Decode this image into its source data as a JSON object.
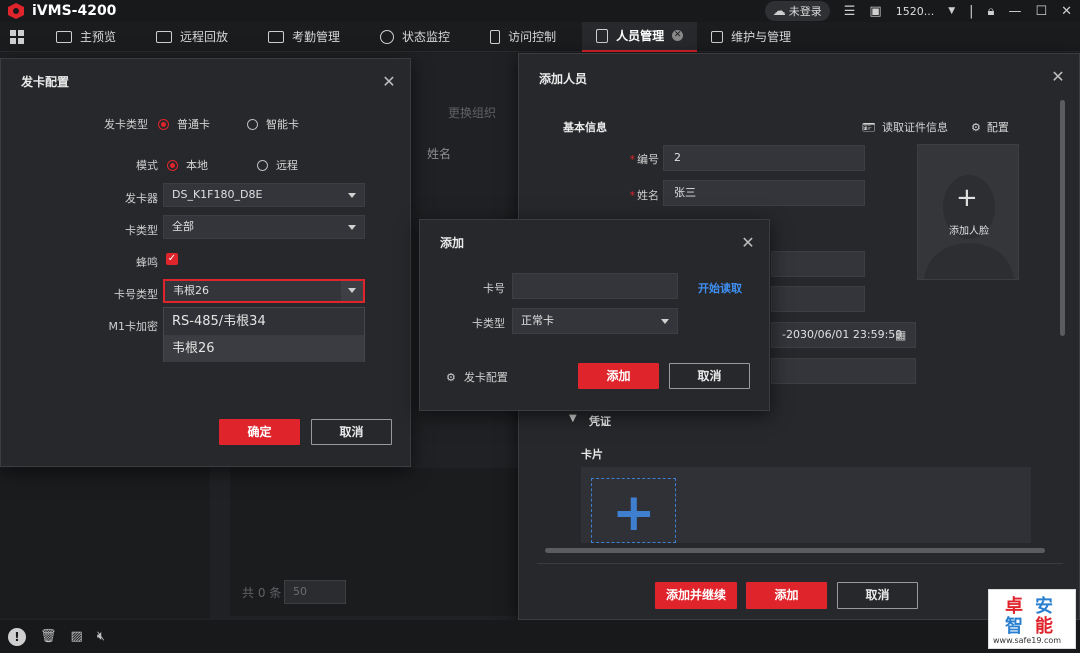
{
  "app": {
    "title": "iVMS-4200"
  },
  "titlebar": {
    "login": "未登录",
    "user": "1520..."
  },
  "nav": {
    "items": [
      {
        "label": "主预览"
      },
      {
        "label": "远程回放"
      },
      {
        "label": "考勤管理"
      },
      {
        "label": "状态监控"
      },
      {
        "label": "访问控制"
      },
      {
        "label": "人员管理"
      },
      {
        "label": "维护与管理"
      }
    ]
  },
  "background": {
    "change_org": "更换组织",
    "name_header": "姓名",
    "total": "共 0 条",
    "page_size": "50"
  },
  "card_config_dialog": {
    "title": "发卡配置",
    "issue_type_label": "发卡类型",
    "issue_type_options": [
      "普通卡",
      "智能卡"
    ],
    "mode_label": "模式",
    "mode_options": [
      "本地",
      "远程"
    ],
    "issuer_label": "发卡器",
    "issuer_value": "DS_K1F180_D8E",
    "card_type_label": "卡类型",
    "card_type_value": "全部",
    "buzzer_label": "蜂鸣",
    "card_no_type_label": "卡号类型",
    "card_no_type_value": "韦根26",
    "card_no_type_options": [
      "RS-485/韦根34",
      "韦根26"
    ],
    "m1_label": "M1卡加密",
    "ok": "确定",
    "cancel": "取消"
  },
  "add_person_dialog": {
    "title": "添加人员",
    "basic_info": "基本信息",
    "read_id": "读取证件信息",
    "config": "配置",
    "id_label": "编号",
    "id_value": "2",
    "name_label": "姓名",
    "name_value": "张三",
    "add_face": "添加人脸",
    "validity_value": "-2030/06/01 23:59:59",
    "credentials": "凭证",
    "card_section": "卡片",
    "add_continue": "添加并继续",
    "add": "添加",
    "cancel": "取消"
  },
  "add_card_dialog": {
    "title": "添加",
    "card_no_label": "卡号",
    "card_no_value": "",
    "start_read": "开始读取",
    "card_type_label": "卡类型",
    "card_type_value": "正常卡",
    "card_config": "发卡配置",
    "add": "添加",
    "cancel": "取消"
  },
  "watermark": {
    "line1a": "卓",
    "line1b": "安",
    "line2a": "智",
    "line2b": "能",
    "url": "www.safe19.com"
  }
}
